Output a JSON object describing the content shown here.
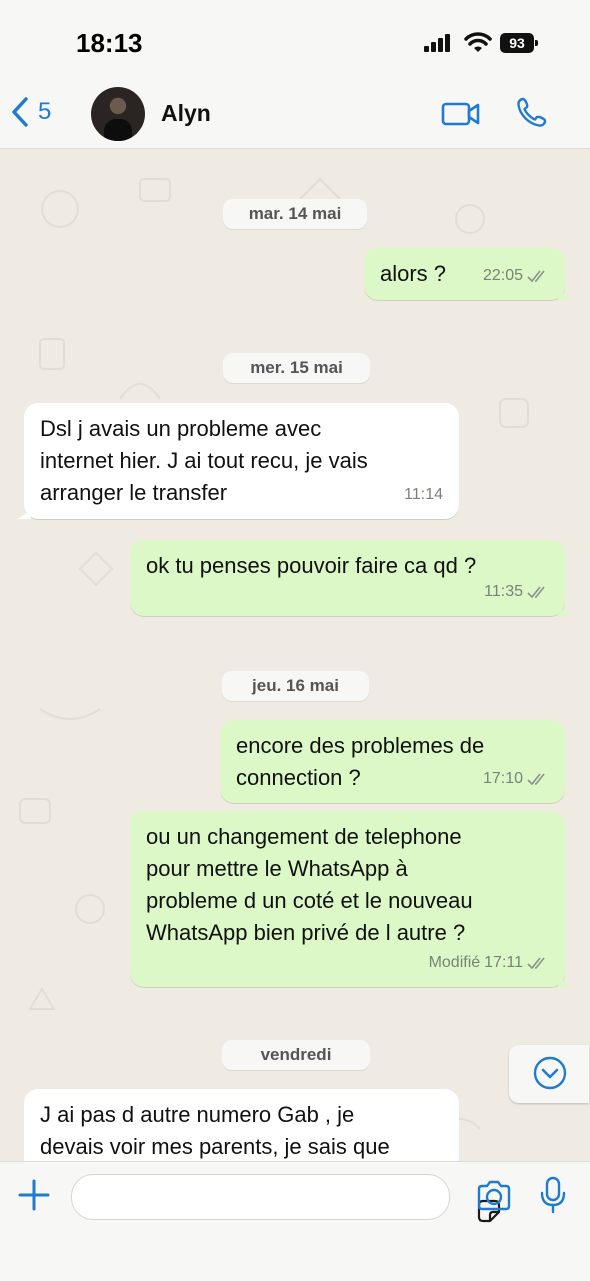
{
  "status": {
    "time": "18:13",
    "battery": "93"
  },
  "header": {
    "back_count": "5",
    "contact_name": "Alyn"
  },
  "colors": {
    "accent": "#1f7ad1",
    "outgoing_bubble": "#dcf8c6",
    "incoming_bubble": "#ffffff",
    "chat_bg": "#efeae2"
  },
  "icons": [
    "back-chevron-icon",
    "video-call-icon",
    "phone-icon",
    "scroll-down-icon",
    "plus-icon",
    "sticker-icon",
    "camera-icon",
    "mic-icon",
    "double-check-icon"
  ],
  "chat": {
    "dates": [
      "mar. 14 mai",
      "mer. 15 mai",
      "jeu. 16 mai",
      "vendredi"
    ],
    "messages": [
      {
        "dir": "out",
        "text": "alors ?",
        "time": "22:05",
        "edited": ""
      },
      {
        "dir": "in",
        "text": "Dsl j avais un probleme avec\ninternet hier. J ai tout recu, je vais\narranger le transfer",
        "time": "11:14",
        "edited": ""
      },
      {
        "dir": "out",
        "text": "ok tu penses pouvoir faire ca qd ?",
        "time": "11:35",
        "edited": ""
      },
      {
        "dir": "out",
        "text": "encore des problemes de\nconnection ?",
        "time": "17:10",
        "edited": ""
      },
      {
        "dir": "out",
        "text": "ou un changement de telephone\npour mettre le WhatsApp à\nprobleme d un coté et le nouveau\nWhatsApp bien privé de l autre ?",
        "time": "17:11",
        "edited": "Modifié"
      },
      {
        "dir": "in",
        "text": "J ai pas d autre numero Gab , je\ndevais voir mes parents, je sais que",
        "time": "",
        "edited": ""
      }
    ]
  },
  "input": {
    "placeholder": ""
  }
}
